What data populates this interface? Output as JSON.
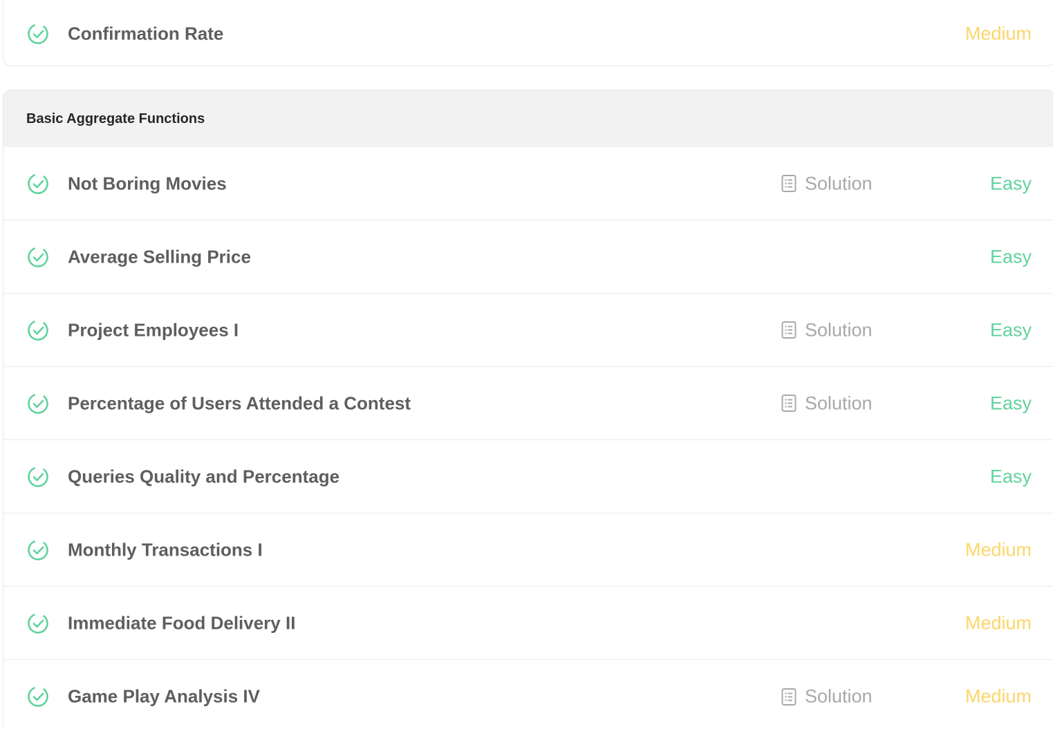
{
  "top_item": {
    "title": "Confirmation Rate",
    "difficulty": "Medium",
    "difficulty_level": "medium",
    "solved": true,
    "has_solution": false
  },
  "section": {
    "title": "Basic Aggregate Functions",
    "solution_label": "Solution",
    "items": [
      {
        "title": "Not Boring Movies",
        "difficulty": "Easy",
        "difficulty_level": "easy",
        "solved": true,
        "has_solution": true
      },
      {
        "title": "Average Selling Price",
        "difficulty": "Easy",
        "difficulty_level": "easy",
        "solved": true,
        "has_solution": false
      },
      {
        "title": "Project Employees I",
        "difficulty": "Easy",
        "difficulty_level": "easy",
        "solved": true,
        "has_solution": true
      },
      {
        "title": "Percentage of Users Attended a Contest",
        "difficulty": "Easy",
        "difficulty_level": "easy",
        "solved": true,
        "has_solution": true
      },
      {
        "title": "Queries Quality and Percentage",
        "difficulty": "Easy",
        "difficulty_level": "easy",
        "solved": true,
        "has_solution": false
      },
      {
        "title": "Monthly Transactions I",
        "difficulty": "Medium",
        "difficulty_level": "medium",
        "solved": true,
        "has_solution": false
      },
      {
        "title": "Immediate Food Delivery II",
        "difficulty": "Medium",
        "difficulty_level": "medium",
        "solved": true,
        "has_solution": false
      },
      {
        "title": "Game Play Analysis IV",
        "difficulty": "Medium",
        "difficulty_level": "medium",
        "solved": true,
        "has_solution": true
      }
    ]
  },
  "colors": {
    "check": "#5fd39c",
    "easy": "#5fd39c",
    "medium": "#fcd669",
    "title_text": "#5e5e5e",
    "muted_text": "#a8a8a8",
    "header_bg": "#f2f2f2"
  },
  "icons": {
    "solved": "check-circle-icon",
    "solution": "document-list-icon"
  }
}
